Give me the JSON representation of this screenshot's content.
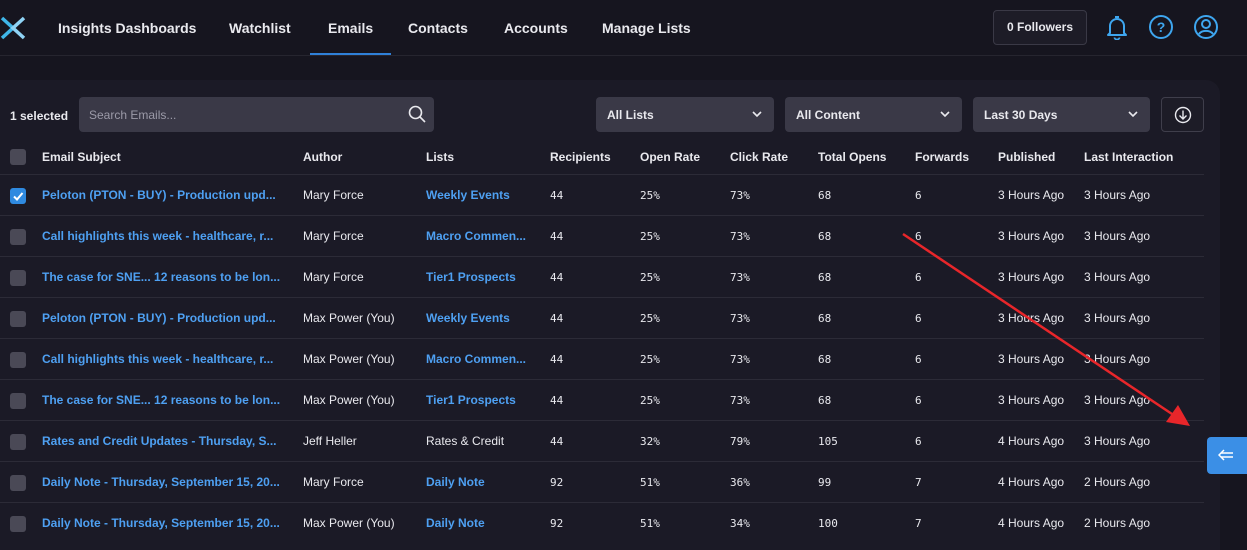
{
  "nav": {
    "items": [
      {
        "label": "Insights Dashboards"
      },
      {
        "label": "Watchlist"
      },
      {
        "label": "Emails"
      },
      {
        "label": "Contacts"
      },
      {
        "label": "Accounts"
      },
      {
        "label": "Manage Lists"
      }
    ],
    "active": "Emails",
    "followers": "0 Followers",
    "icons": [
      "bell-icon",
      "help-icon",
      "user-icon"
    ]
  },
  "toolbar": {
    "selected_count": "1 selected",
    "search_placeholder": "Search Emails...",
    "filters": [
      "All Lists",
      "All Content",
      "Last 30 Days"
    ]
  },
  "table": {
    "headers": [
      "Email Subject",
      "Author",
      "Lists",
      "Recipients",
      "Open Rate",
      "Click Rate",
      "Total Opens",
      "Forwards",
      "Published",
      "Last Interaction"
    ],
    "rows": [
      {
        "checked": true,
        "subject": "Peloton (PTON - BUY) - Production upd...",
        "author": "Mary Force",
        "list": "Weekly Events",
        "list_link": true,
        "recipients": "44",
        "open_rate": "25%",
        "click_rate": "73%",
        "total_opens": "68",
        "forwards": "6",
        "published": "3 Hours Ago",
        "last_interaction": "3 Hours Ago"
      },
      {
        "checked": false,
        "subject": "Call highlights this week - healthcare, r...",
        "author": "Mary Force",
        "list": "Macro Commen...",
        "list_link": true,
        "recipients": "44",
        "open_rate": "25%",
        "click_rate": "73%",
        "total_opens": "68",
        "forwards": "6",
        "published": "3 Hours Ago",
        "last_interaction": "3 Hours Ago"
      },
      {
        "checked": false,
        "subject": "The case for SNE... 12 reasons to be lon...",
        "author": "Mary Force",
        "list": "Tier1 Prospects",
        "list_link": true,
        "recipients": "44",
        "open_rate": "25%",
        "click_rate": "73%",
        "total_opens": "68",
        "forwards": "6",
        "published": "3 Hours Ago",
        "last_interaction": "3 Hours Ago"
      },
      {
        "checked": false,
        "subject": "Peloton (PTON - BUY) - Production upd...",
        "author": "Max Power (You)",
        "list": "Weekly Events",
        "list_link": true,
        "recipients": "44",
        "open_rate": "25%",
        "click_rate": "73%",
        "total_opens": "68",
        "forwards": "6",
        "published": "3 Hours Ago",
        "last_interaction": "3 Hours Ago"
      },
      {
        "checked": false,
        "subject": "Call highlights this week - healthcare, r...",
        "author": "Max Power (You)",
        "list": "Macro Commen...",
        "list_link": true,
        "recipients": "44",
        "open_rate": "25%",
        "click_rate": "73%",
        "total_opens": "68",
        "forwards": "6",
        "published": "3 Hours Ago",
        "last_interaction": "3 Hours Ago"
      },
      {
        "checked": false,
        "subject": "The case for SNE... 12 reasons to be lon...",
        "author": "Max Power (You)",
        "list": "Tier1 Prospects",
        "list_link": true,
        "recipients": "44",
        "open_rate": "25%",
        "click_rate": "73%",
        "total_opens": "68",
        "forwards": "6",
        "published": "3 Hours Ago",
        "last_interaction": "3 Hours Ago"
      },
      {
        "checked": false,
        "subject": "Rates and Credit Updates - Thursday, S...",
        "author": "Jeff Heller",
        "list": "Rates & Credit",
        "list_link": false,
        "recipients": "44",
        "open_rate": "32%",
        "click_rate": "79%",
        "total_opens": "105",
        "forwards": "6",
        "published": "4 Hours Ago",
        "last_interaction": "3 Hours Ago"
      },
      {
        "checked": false,
        "subject": "Daily Note - Thursday, September 15, 20...",
        "author": "Mary Force",
        "list": "Daily Note",
        "list_link": true,
        "recipients": "92",
        "open_rate": "51%",
        "click_rate": "36%",
        "total_opens": "99",
        "forwards": "7",
        "published": "4 Hours Ago",
        "last_interaction": "2 Hours Ago"
      },
      {
        "checked": false,
        "subject": "Daily Note - Thursday, September 15, 20...",
        "author": "Max Power (You)",
        "list": "Daily Note",
        "list_link": true,
        "recipients": "92",
        "open_rate": "51%",
        "click_rate": "34%",
        "total_opens": "100",
        "forwards": "7",
        "published": "4 Hours Ago",
        "last_interaction": "2 Hours Ago"
      }
    ]
  },
  "colors": {
    "background": "#16151f",
    "panel": "#1b1a26",
    "accent": "#2f80d8",
    "link": "#4ea0f2",
    "annotation_arrow": "#e8262a"
  },
  "annotation": {
    "type": "arrow",
    "target": "side-panel-toggle-button"
  }
}
